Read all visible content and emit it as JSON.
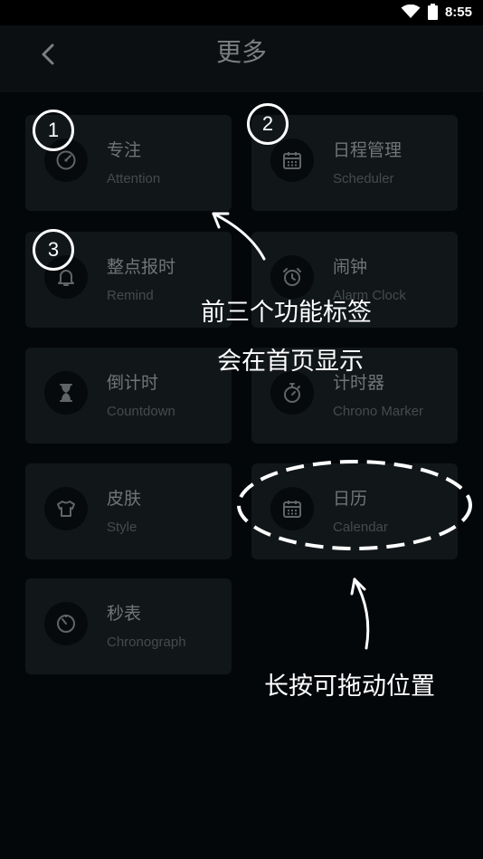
{
  "status_bar": {
    "time": "8:55",
    "icons": [
      "wifi-icon",
      "battery-icon"
    ]
  },
  "header": {
    "title": "更多",
    "back_icon": "chevron-left-icon"
  },
  "cards": [
    {
      "title": "专注",
      "subtitle": "Attention",
      "icon": "gauge-icon"
    },
    {
      "title": "日程管理",
      "subtitle": "Scheduler",
      "icon": "calendar-icon"
    },
    {
      "title": "整点报时",
      "subtitle": "Remind",
      "icon": "bell-icon"
    },
    {
      "title": "闹钟",
      "subtitle": "Alarm Clock",
      "icon": "alarm-clock-icon"
    },
    {
      "title": "倒计时",
      "subtitle": "Countdown",
      "icon": "hourglass-icon"
    },
    {
      "title": "计时器",
      "subtitle": "Chrono Marker",
      "icon": "stopwatch-icon"
    },
    {
      "title": "皮肤",
      "subtitle": "Style",
      "icon": "shirt-icon"
    },
    {
      "title": "日历",
      "subtitle": "Calendar",
      "icon": "calendar-icon"
    },
    {
      "title": "秒表",
      "subtitle": "Chronograph",
      "icon": "timer-icon"
    }
  ],
  "annotations": {
    "markers": [
      "1",
      "2",
      "3"
    ],
    "first_three_line1": "前三个功能标签",
    "first_three_line2": "会在首页显示",
    "long_press": "长按可拖动位置"
  },
  "colors": {
    "background": "#03070a",
    "header": "#0b0f12",
    "card": "#111619",
    "annotation": "#ffffff"
  }
}
